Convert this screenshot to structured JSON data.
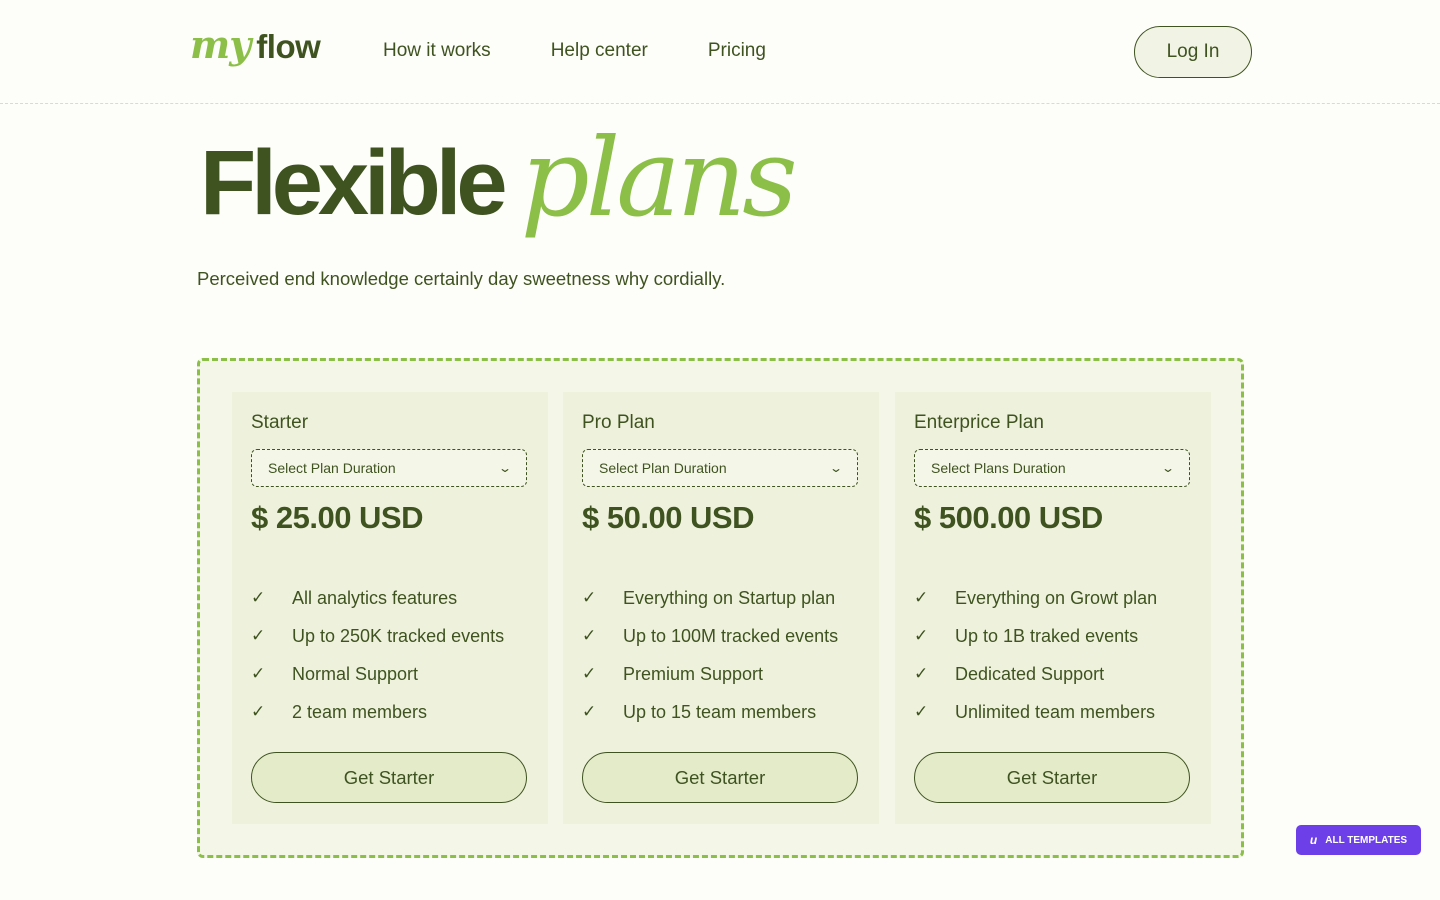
{
  "brand": {
    "logo_my": "my",
    "logo_flow": "flow"
  },
  "nav": {
    "items": [
      {
        "label": "How it works"
      },
      {
        "label": "Help center"
      },
      {
        "label": "Pricing"
      }
    ],
    "login_label": "Log In"
  },
  "hero": {
    "title_part1": "Flexible",
    "title_part2": "plans",
    "subtitle": "Perceived end knowledge certainly day sweetness why cordially."
  },
  "plans": [
    {
      "name": "Starter",
      "select_placeholder": "Select Plan Duration",
      "price": "$ 25.00 USD",
      "features": [
        "All analytics features",
        "Up to 250K tracked events",
        "Normal Support",
        "2 team members"
      ],
      "button_label": "Get Starter"
    },
    {
      "name": "Pro Plan",
      "select_placeholder": "Select Plan Duration",
      "price": "$ 50.00 USD",
      "features": [
        "Everything on Startup plan",
        "Up to 100M tracked events",
        "Premium Support",
        "Up to 15 team members"
      ],
      "button_label": "Get Starter"
    },
    {
      "name": "Enterprice Plan",
      "select_placeholder": "Select Plans Duration",
      "price": "$ 500.00 USD",
      "features": [
        "Everything on Growt plan",
        "Up to 1B traked events",
        "Dedicated Support",
        "Unlimited team members"
      ],
      "button_label": "Get Starter"
    }
  ],
  "badge": {
    "icon_text": "u",
    "label": "ALL TEMPLATES"
  },
  "colors": {
    "dark_green": "#3f5320",
    "accent_green": "#8cbf48",
    "badge_purple": "#6d3fe8"
  }
}
